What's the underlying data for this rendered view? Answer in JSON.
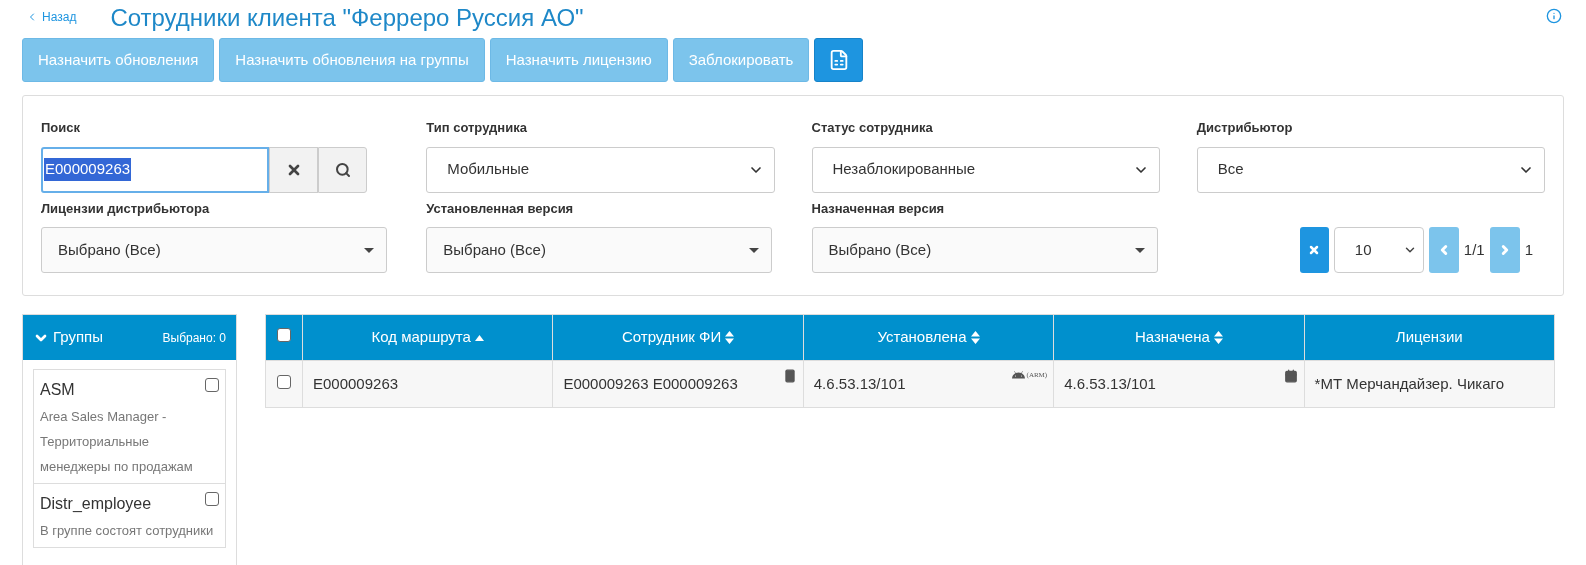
{
  "header": {
    "back_link": "Назад",
    "title": "Сотрудники клиента \"Ферреро Руссия АО\""
  },
  "toolbar": {
    "buttons": [
      {
        "label": "Назначить обновления",
        "disabled": true
      },
      {
        "label": "Назначить обновления на группы",
        "disabled": true
      },
      {
        "label": "Назначить лицензию",
        "disabled": true
      },
      {
        "label": "Заблокировать",
        "disabled": true
      }
    ],
    "export_button": {
      "disabled": false
    }
  },
  "filters": {
    "search": {
      "label": "Поиск",
      "value": "E000009263"
    },
    "fields": [
      {
        "kind": "native",
        "label": "Тип сотрудника",
        "value": "Мобильные"
      },
      {
        "kind": "native",
        "label": "Статус сотрудника",
        "value": "Незаблокированные"
      },
      {
        "kind": "native",
        "label": "Дистрибьютор",
        "value": "Все"
      },
      {
        "kind": "multi",
        "label": "Лицензии дистрибьютора",
        "value": "Выбрано (Все)"
      },
      {
        "kind": "multi",
        "label": "Установленная версия",
        "value": "Выбрано (Все)"
      },
      {
        "kind": "multi",
        "label": "Назначенная версия",
        "value": "Выбрано (Все)"
      }
    ],
    "pagination": {
      "page_size": "10",
      "page": "1/1",
      "total": "1",
      "prev_disabled": true,
      "next_disabled": true
    }
  },
  "groups": {
    "title": "Группы",
    "expanded": true,
    "selected_count": "Выбрано: 0",
    "items": [
      {
        "name": "ASM",
        "description": "Area Sales Manager - Территориальные менеджеры по продажам",
        "checked": false
      },
      {
        "name": "Distr_employee",
        "description": "В группе состоят сотрудники",
        "checked": false
      }
    ]
  },
  "table": {
    "header_checked": false,
    "columns": [
      {
        "label": "Код маршрута",
        "kind": "sorted"
      },
      {
        "label": "Сотрудник ФИ",
        "kind": "sortable"
      },
      {
        "label": "Установлена",
        "kind": "sortable"
      },
      {
        "label": "Назначена",
        "kind": "sortable"
      },
      {
        "label": "Лицензии",
        "kind": "plain"
      }
    ],
    "rows": [
      {
        "checked": false,
        "cells": [
          {
            "kind": "plain",
            "text": "E000009263"
          },
          {
            "kind": "device",
            "text": "E000009263 E000009263"
          },
          {
            "kind": "android",
            "text": "4.6.53.13/101",
            "tag": "(ARM)"
          },
          {
            "kind": "calendar",
            "text": "4.6.53.13/101"
          },
          {
            "kind": "plain",
            "text": "*МТ Мерчандайзер. Чикаго"
          }
        ]
      }
    ]
  }
}
